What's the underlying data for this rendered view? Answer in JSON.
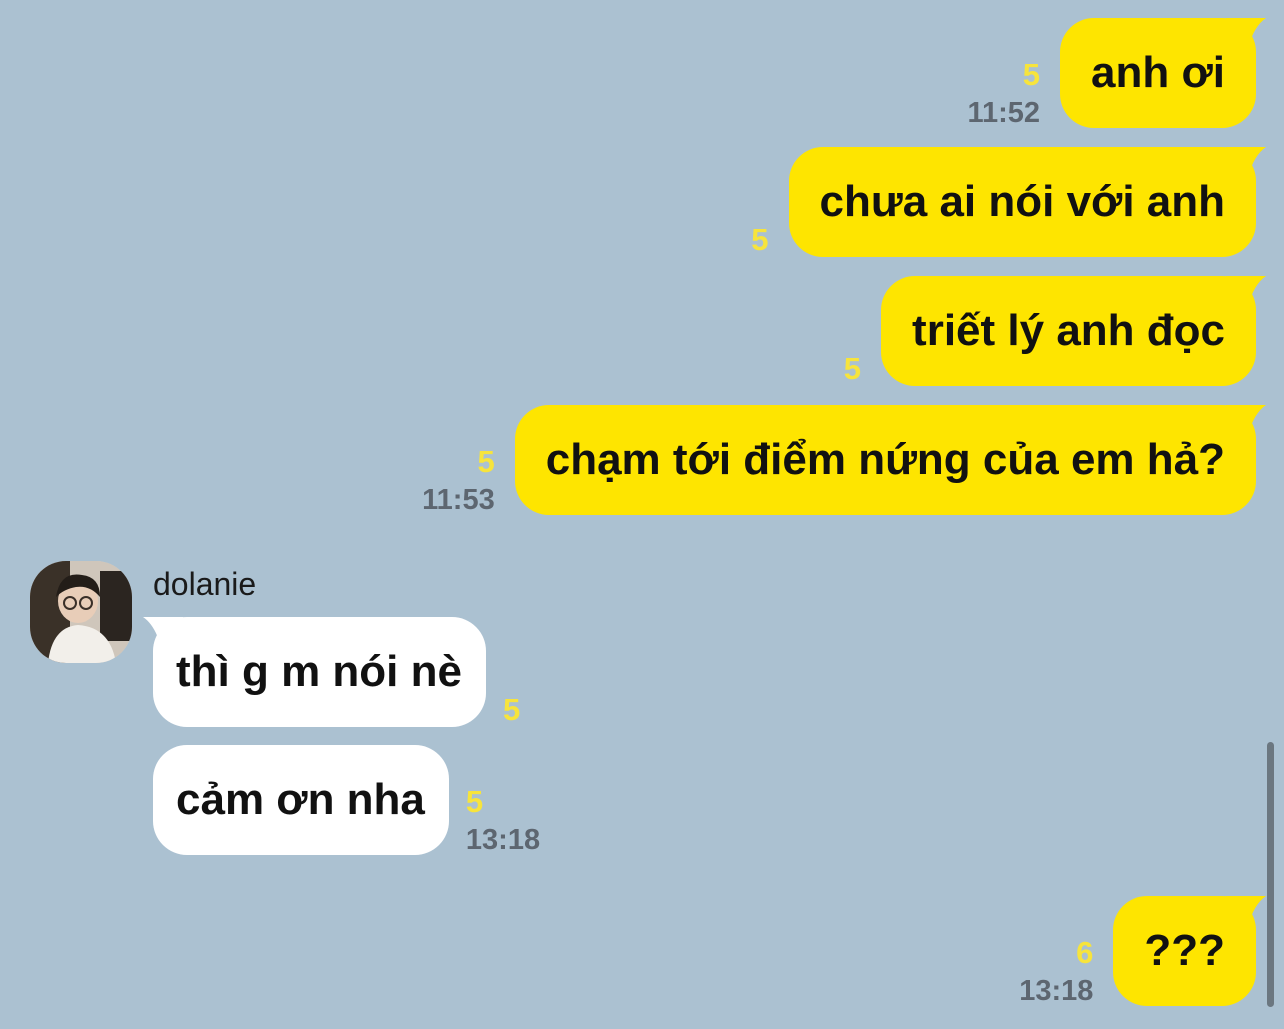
{
  "conversation": {
    "messages": [
      {
        "direction": "out",
        "text": "anh ơi",
        "unread": "5",
        "time": "11:52"
      },
      {
        "direction": "out",
        "text": "chưa ai nói với anh",
        "unread": "5",
        "time": ""
      },
      {
        "direction": "out",
        "text": "triết lý anh đọc",
        "unread": "5",
        "time": ""
      },
      {
        "direction": "out",
        "text": "chạm tới điểm nứng của em hả?",
        "unread": "5",
        "time": "11:53"
      },
      {
        "direction": "in",
        "text": "thì g m nói nè",
        "unread": "5",
        "time": ""
      },
      {
        "direction": "in",
        "text": "cảm ơn nha",
        "unread": "5",
        "time": "13:18"
      },
      {
        "direction": "out",
        "text": "???",
        "unread": "6",
        "time": "13:18"
      }
    ]
  },
  "sender": {
    "name": "dolanie",
    "avatar": "profile-photo"
  },
  "colors": {
    "background": "#abc1d1",
    "outgoing_bubble": "#fee500",
    "incoming_bubble": "#ffffff",
    "unread_count": "#f7e43c",
    "timestamp": "#5d6670"
  }
}
